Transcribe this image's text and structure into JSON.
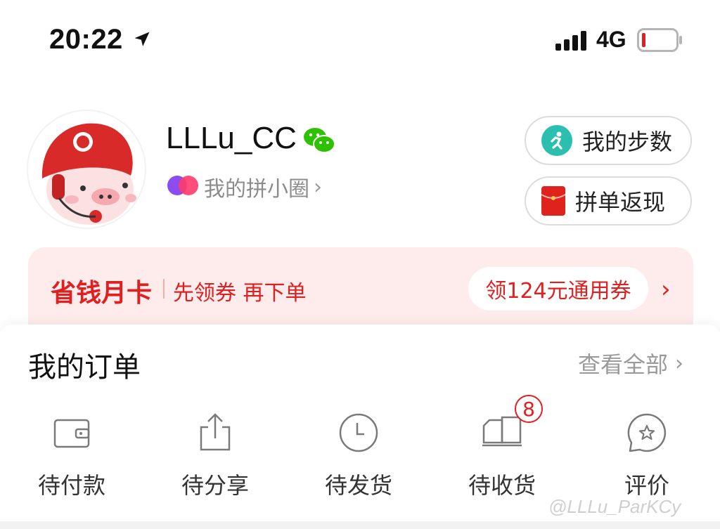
{
  "status_bar": {
    "time": "20:22",
    "network": "4G",
    "battery_color": "#e02020"
  },
  "profile": {
    "username": "LLLu_CC",
    "circle_link": "我的拼小圈",
    "buttons": {
      "steps": "我的步数",
      "cashback": "拼单返现"
    }
  },
  "banner": {
    "title": "省钱月卡",
    "subtitle": "先领券 再下单",
    "coupon": "领124元通用券"
  },
  "orders": {
    "title": "我的订单",
    "view_all": "查看全部",
    "items": [
      {
        "label": "待付款",
        "icon": "wallet-icon"
      },
      {
        "label": "待分享",
        "icon": "share-icon"
      },
      {
        "label": "待发货",
        "icon": "clock-icon"
      },
      {
        "label": "待收货",
        "icon": "truck-icon",
        "badge": "8"
      },
      {
        "label": "评价",
        "icon": "review-star-icon"
      }
    ]
  },
  "watermark": "@LLLu_ParKCy",
  "colors": {
    "accent_red": "#e02020",
    "banner_bg": "#fdeceb",
    "steps_teal": "#2bbfb0",
    "wechat_green": "#2dc100"
  }
}
